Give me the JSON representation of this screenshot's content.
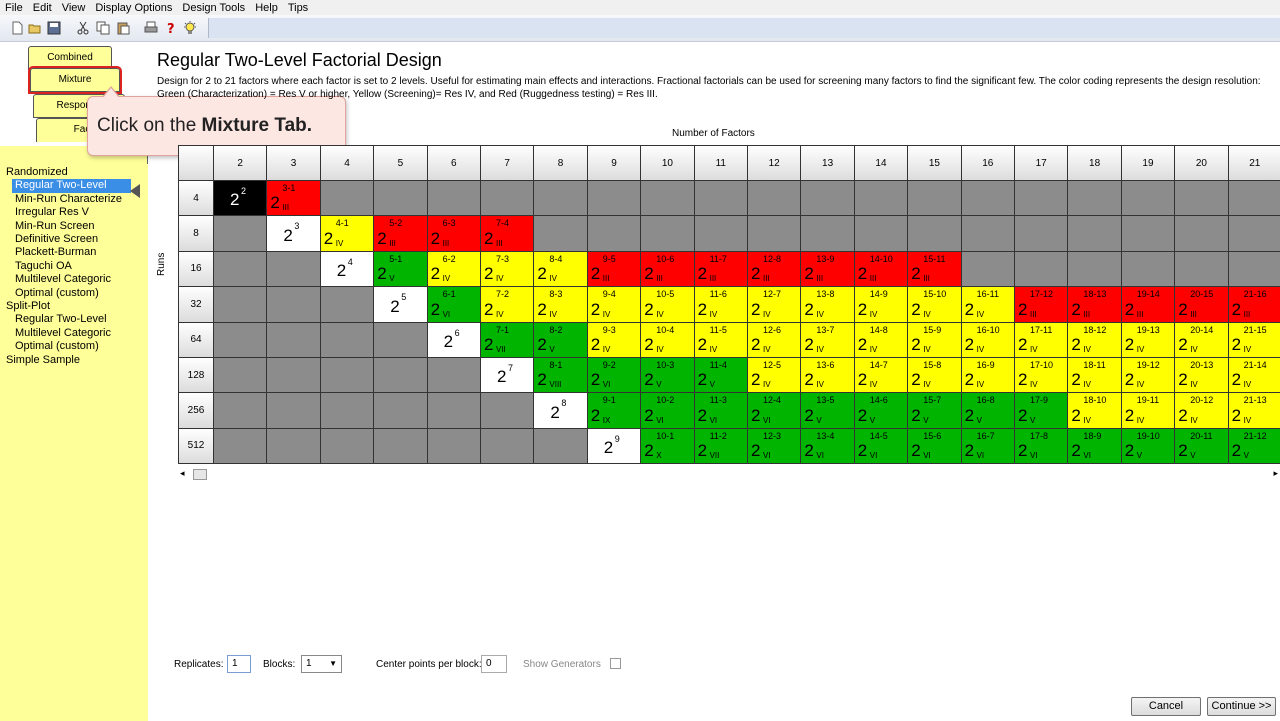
{
  "menu": [
    "File",
    "Edit",
    "View",
    "Display Options",
    "Design Tools",
    "Help",
    "Tips"
  ],
  "toolbar": {
    "icons": [
      "new-icon",
      "open-icon",
      "save-icon",
      "cut-icon",
      "copy-icon",
      "paste-icon",
      "print-icon",
      "help-icon",
      "tip-icon"
    ]
  },
  "tabs": {
    "combined": "Combined",
    "mixture": "Mixture",
    "response": "Response",
    "factorial": "Fac"
  },
  "callout": {
    "prefix": "Click on the ",
    "bold": "Mixture Tab."
  },
  "left_list": [
    {
      "label": "Randomized",
      "level": 0
    },
    {
      "label": "Regular Two-Level",
      "level": 1,
      "selected": true
    },
    {
      "label": "Min-Run Characterize",
      "level": 1
    },
    {
      "label": "Irregular Res V",
      "level": 1
    },
    {
      "label": "Min-Run Screen",
      "level": 1
    },
    {
      "label": "Definitive Screen",
      "level": 1
    },
    {
      "label": "Plackett-Burman",
      "level": 1
    },
    {
      "label": "Taguchi OA",
      "level": 1
    },
    {
      "label": "Multilevel Categoric",
      "level": 1
    },
    {
      "label": "Optimal (custom)",
      "level": 1
    },
    {
      "label": "Split-Plot",
      "level": 0
    },
    {
      "label": "Regular Two-Level",
      "level": 1
    },
    {
      "label": "Multilevel Categoric",
      "level": 1
    },
    {
      "label": "Optimal (custom)",
      "level": 1
    },
    {
      "label": "Simple Sample",
      "level": 0
    }
  ],
  "main": {
    "title": "Regular Two-Level Factorial Design",
    "description": "Design for 2 to 21 factors where each factor is set to 2 levels.  Useful for estimating main effects and interactions.  Fractional factorials can be used for screening many factors to find the significant few. The color coding represents the design resolution: Green (Characterization) = Res V or higher, Yellow (Screening)= Res IV, and Red (Ruggedness testing) = Res III.",
    "factors_label": "Number of Factors",
    "runs_label": "Runs"
  },
  "grid": {
    "factors": [
      "2",
      "3",
      "4",
      "5",
      "6",
      "7",
      "8",
      "9",
      "10",
      "11",
      "12",
      "13",
      "14",
      "15",
      "16",
      "17",
      "18",
      "19",
      "20",
      "21"
    ],
    "runs": [
      "4",
      "8",
      "16",
      "32",
      "64",
      "128",
      "256",
      "512"
    ],
    "rows": [
      [
        "2^2|black",
        "2^3-1^III|red",
        "",
        "",
        "",
        "",
        "",
        "",
        "",
        "",
        "",
        "",
        "",
        "",
        "",
        "",
        "",
        "",
        "",
        ""
      ],
      [
        "",
        "2^3|white",
        "2^4-1^IV|yellow",
        "2^5-2^III|red",
        "2^6-3^III|red",
        "2^7-4^III|red",
        "",
        "",
        "",
        "",
        "",
        "",
        "",
        "",
        "",
        "",
        "",
        "",
        "",
        ""
      ],
      [
        "",
        "",
        "2^4|white",
        "2^5-1^V|green",
        "2^6-2^IV|yellow",
        "2^7-3^IV|yellow",
        "2^8-4^IV|yellow",
        "2^9-5^III|red",
        "2^10-6^III|red",
        "2^11-7^III|red",
        "2^12-8^III|red",
        "2^13-9^III|red",
        "2^14-10^III|red",
        "2^15-11^III|red",
        "",
        "",
        "",
        "",
        "",
        ""
      ],
      [
        "",
        "",
        "",
        "2^5|white",
        "2^6-1^VI|green",
        "2^7-2^IV|yellow",
        "2^8-3^IV|yellow",
        "2^9-4^IV|yellow",
        "2^10-5^IV|yellow",
        "2^11-6^IV|yellow",
        "2^12-7^IV|yellow",
        "2^13-8^IV|yellow",
        "2^14-9^IV|yellow",
        "2^15-10^IV|yellow",
        "2^16-11^IV|yellow",
        "2^17-12^III|red",
        "2^18-13^III|red",
        "2^19-14^III|red",
        "2^20-15^III|red",
        "2^21-16^III|red"
      ],
      [
        "",
        "",
        "",
        "",
        "2^6|white",
        "2^7-1^VII|green",
        "2^8-2^V|green",
        "2^9-3^IV|yellow",
        "2^10-4^IV|yellow",
        "2^11-5^IV|yellow",
        "2^12-6^IV|yellow",
        "2^13-7^IV|yellow",
        "2^14-8^IV|yellow",
        "2^15-9^IV|yellow",
        "2^16-10^IV|yellow",
        "2^17-11^IV|yellow",
        "2^18-12^IV|yellow",
        "2^19-13^IV|yellow",
        "2^20-14^IV|yellow",
        "2^21-15^IV|yellow"
      ],
      [
        "",
        "",
        "",
        "",
        "",
        "2^7|white",
        "2^8-1^VIII|green",
        "2^9-2^VI|green",
        "2^10-3^V|green",
        "2^11-4^V|green",
        "2^12-5^IV|yellow",
        "2^13-6^IV|yellow",
        "2^14-7^IV|yellow",
        "2^15-8^IV|yellow",
        "2^16-9^IV|yellow",
        "2^17-10^IV|yellow",
        "2^18-11^IV|yellow",
        "2^19-12^IV|yellow",
        "2^20-13^IV|yellow",
        "2^21-14^IV|yellow"
      ],
      [
        "",
        "",
        "",
        "",
        "",
        "",
        "2^8|white",
        "2^9-1^IX|green",
        "2^10-2^VI|green",
        "2^11-3^VI|green",
        "2^12-4^VI|green",
        "2^13-5^V|green",
        "2^14-6^V|green",
        "2^15-7^V|green",
        "2^16-8^V|green",
        "2^17-9^V|green",
        "2^18-10^IV|yellow",
        "2^19-11^IV|yellow",
        "2^20-12^IV|yellow",
        "2^21-13^IV|yellow"
      ],
      [
        "",
        "",
        "",
        "",
        "",
        "",
        "",
        "2^9|white",
        "2^10-1^X|green",
        "2^11-2^VII|green",
        "2^12-3^VI|green",
        "2^13-4^VI|green",
        "2^14-5^VI|green",
        "2^15-6^VI|green",
        "2^16-7^VI|green",
        "2^17-8^VI|green",
        "2^18-9^VI|green",
        "2^19-10^V|green",
        "2^20-11^V|green",
        "2^21-12^V|green"
      ]
    ]
  },
  "controls": {
    "replicates_label": "Replicates:",
    "replicates_value": "1",
    "blocks_label": "Blocks:",
    "blocks_value": "1",
    "center_label": "Center points per block:",
    "center_value": "0",
    "show_generators_label": "Show Generators",
    "cancel": "Cancel",
    "continue": "Continue >>"
  },
  "colors": {
    "red": "#ff0000",
    "yellow": "#ffff00",
    "green": "#00b400",
    "gray": "#8c8c8c",
    "white": "#ffffff",
    "black": "#000000",
    "panel": "#ffff99",
    "selection": "#3a8ee6"
  }
}
